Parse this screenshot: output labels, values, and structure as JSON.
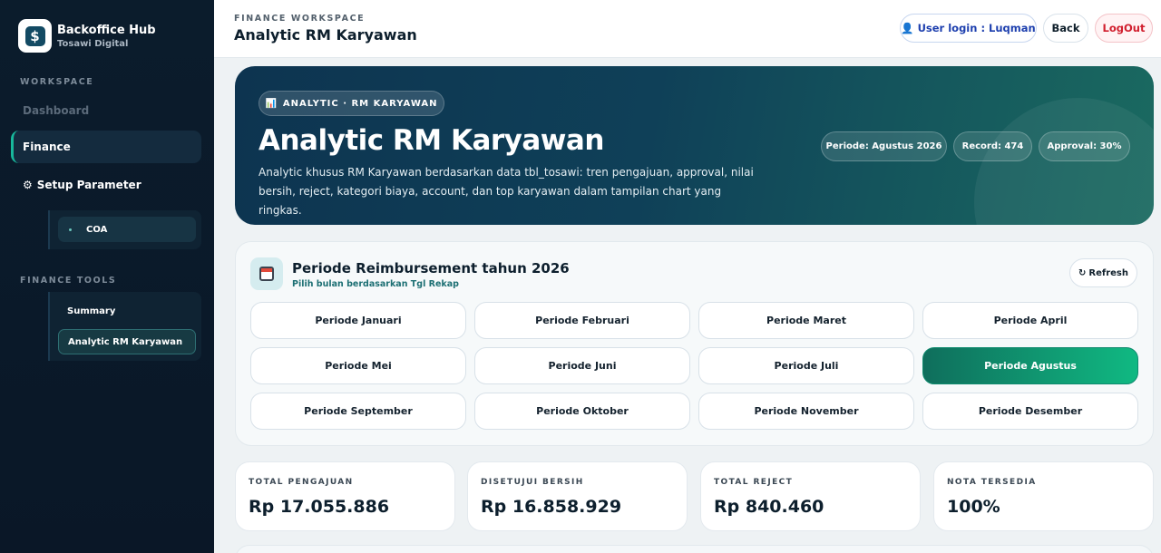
{
  "sidebar": {
    "brand_title": "Backoffice Hub",
    "brand_subtitle": "Tosawi Digital",
    "workspace_label": "WORKSPACE",
    "items": {
      "dashboard": "Dashboard",
      "finance": "Finance",
      "setup_parameter": "Setup Parameter",
      "coa": "COA"
    },
    "finance_tools_label": "FINANCE TOOLS",
    "tools": {
      "summary": "Summary",
      "analytic_rm": "Analytic RM Karyawan"
    }
  },
  "topbar": {
    "eyebrow": "FINANCE WORKSPACE",
    "title": "Analytic RM Karyawan",
    "user_login": "User login : Luqman",
    "back": "Back",
    "logout": "LogOut"
  },
  "hero": {
    "tag": "ANALYTIC · RM KARYAWAN",
    "title": "Analytic RM Karyawan",
    "description": "Analytic khusus RM Karyawan berdasarkan data tbl_tosawi: tren pengajuan, approval, nilai bersih, reject, kategori biaya, account, dan top karyawan dalam tampilan chart yang ringkas.",
    "chips": {
      "periode": "Periode: Agustus 2026",
      "record": "Record: 474",
      "approval": "Approval: 30%"
    }
  },
  "period": {
    "title": "Periode Reimbursement tahun 2026",
    "subtitle": "Pilih bulan berdasarkan Tgl Rekap",
    "refresh": "Refresh",
    "months": {
      "jan": "Periode Januari",
      "feb": "Periode Februari",
      "mar": "Periode Maret",
      "apr": "Periode April",
      "mei": "Periode Mei",
      "jun": "Periode Juni",
      "jul": "Periode Juli",
      "agu": "Periode Agustus",
      "sep": "Periode September",
      "okt": "Periode Oktober",
      "nov": "Periode November",
      "des": "Periode Desember"
    },
    "selected": "Periode Agustus"
  },
  "stats": {
    "total_pengajuan": {
      "label": "TOTAL PENGAJUAN",
      "value": "Rp 17.055.886"
    },
    "disetujui_bersih": {
      "label": "DISETUJUI BERSIH",
      "value": "Rp 16.858.929"
    },
    "total_reject": {
      "label": "TOTAL REJECT",
      "value": "Rp 840.460"
    },
    "nota_tersedia": {
      "label": "NOTA TERSEDIA",
      "value": "100%"
    }
  },
  "icons": {
    "brand": "logo-icon",
    "user": "user-icon",
    "gear": "gear-icon",
    "chart": "bar-chart-icon",
    "calendar": "calendar-icon",
    "refresh": "refresh-icon"
  },
  "colors": {
    "accent": "#10b982",
    "sidebar_bg": "#0b1c2c",
    "hero_bg": "#0f4058",
    "logout": "#d11f2e"
  }
}
